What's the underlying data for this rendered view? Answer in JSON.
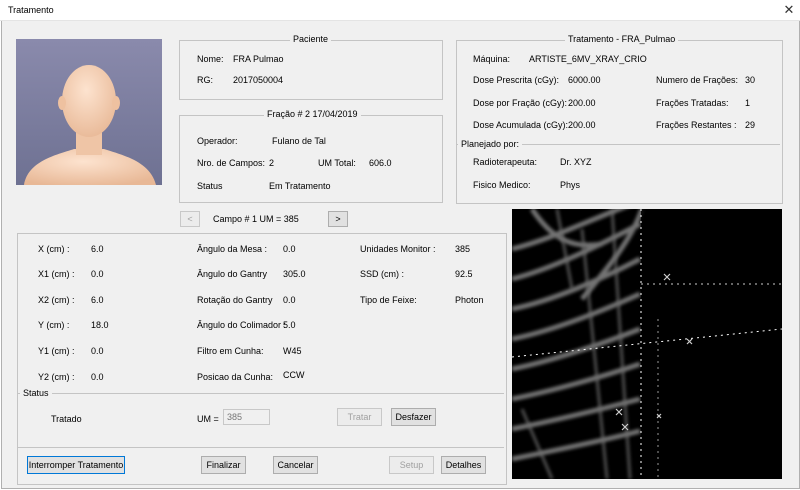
{
  "window": {
    "title": "Tratamento",
    "close_glyph": "✕"
  },
  "paciente": {
    "legend": "Paciente",
    "nome_label": "Nome:",
    "nome_value": "FRA Pulmao",
    "rg_label": "RG:",
    "rg_value": "2017050004"
  },
  "fracao": {
    "legend": "Fração # 2  17/04/2019",
    "operador_label": "Operador:",
    "operador_value": "Fulano de Tal",
    "campos_label": "Nro. de Campos:",
    "campos_value": "2",
    "umtotal_label": "UM Total:",
    "umtotal_value": "606.0",
    "status_label": "Status",
    "status_value": "Em Tratamento"
  },
  "tratamento": {
    "legend": "Tratamento - FRA_Pulmao",
    "maquina_label": "Máquina:",
    "maquina_value": "ARTISTE_6MV_XRAY_CRIO",
    "dose_prescrita_label": "Dose Prescrita (cGy):",
    "dose_prescrita_value": "6000.00",
    "numero_fracoes_label": "Numero de Frações:",
    "numero_fracoes_value": "30",
    "dose_fracao_label": "Dose por Fração (cGy):",
    "dose_fracao_value": "200.00",
    "fracoes_tratadas_label": "Frações Tratadas:",
    "fracoes_tratadas_value": "1",
    "dose_acumulada_label": "Dose Acumulada (cGy):",
    "dose_acumulada_value": "200.00",
    "fracoes_restantes_label": "Frações Restantes :",
    "fracoes_restantes_value": "29",
    "planejado_legend": "Planejado por:",
    "radioterapeuta_label": "Radioterapeuta:",
    "radioterapeuta_value": "Dr. XYZ",
    "fisico_label": "Fisico Medico:",
    "fisico_value": "Phys"
  },
  "campo_nav": {
    "prev": "<",
    "next": ">",
    "label": "Campo # 1   UM = 385"
  },
  "campo": {
    "col1": [
      {
        "label": "X (cm) :",
        "value": "6.0"
      },
      {
        "label": "X1 (cm) :",
        "value": "0.0"
      },
      {
        "label": "X2 (cm) :",
        "value": "6.0"
      },
      {
        "label": "Y  (cm) :",
        "value": "18.0"
      },
      {
        "label": "Y1 (cm) :",
        "value": "0.0"
      },
      {
        "label": "Y2 (cm) :",
        "value": "0.0"
      }
    ],
    "col2": [
      {
        "label": "Ângulo da Mesa :",
        "value": "0.0"
      },
      {
        "label": "Ângulo do Gantry",
        "value": "305.0"
      },
      {
        "label": "Rotação do Gantry",
        "value": "0.0"
      },
      {
        "label": "Ângulo do Colimador :",
        "value": "5.0"
      },
      {
        "label": "Filtro em Cunha:",
        "value": "W45"
      },
      {
        "label": "Posicao da Cunha:",
        "value": "CCW"
      }
    ],
    "col3": [
      {
        "label": "Unidades Monitor :",
        "value": "385"
      },
      {
        "label": "SSD (cm) :",
        "value": "92.5"
      },
      {
        "label": "Tipo de Feixe:",
        "value": "Photon"
      }
    ]
  },
  "status": {
    "legend": "Status",
    "value": "Tratado",
    "um_label": "UM =",
    "um_placeholder": "385",
    "tratar": "Tratar",
    "desfazer": "Desfazer"
  },
  "buttons": {
    "interromper": "Interromper Tratamento",
    "finalizar": "Finalizar",
    "cancelar": "Cancelar",
    "setup": "Setup",
    "detalhes": "Detalhes"
  },
  "icons": {
    "close": "close-icon",
    "patient_photo": "patient-photo",
    "xray": "xray-image"
  }
}
